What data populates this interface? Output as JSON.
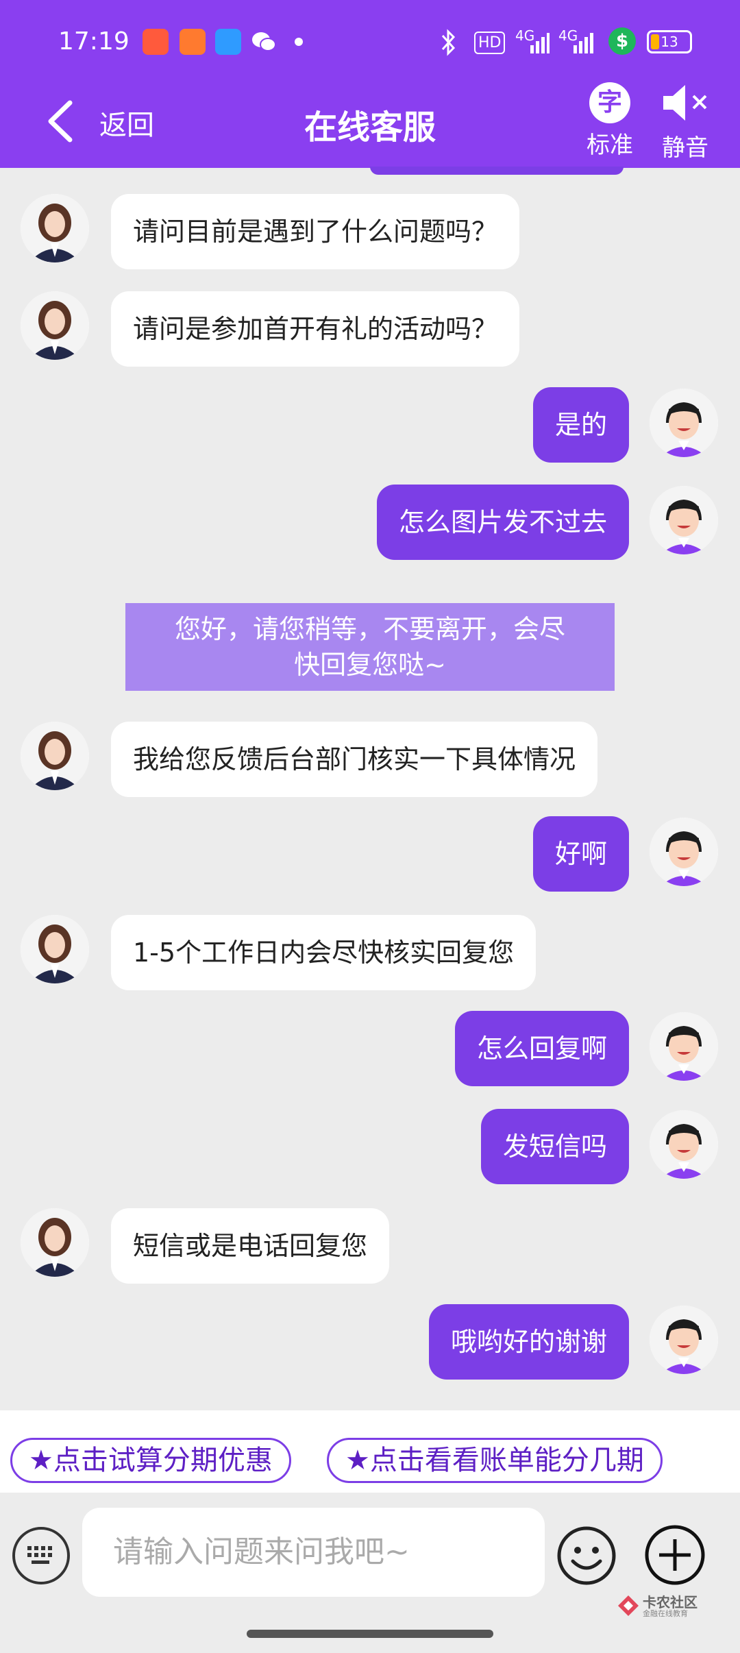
{
  "status_bar": {
    "time": "17:19",
    "battery": "13",
    "network_labels": [
      "HD",
      "4G",
      "4G"
    ]
  },
  "header": {
    "back_label": "返回",
    "title": "在线客服",
    "mode_icon_char": "字",
    "mode_label": "标准",
    "mute_label": "静音"
  },
  "messages": [
    {
      "side": "in",
      "text": "请问目前是遇到了什么问题吗？"
    },
    {
      "side": "in",
      "text": "请问是参加首开有礼的活动吗？"
    },
    {
      "side": "out",
      "text": "是的"
    },
    {
      "side": "out",
      "text": "怎么图片发不过去"
    },
    {
      "side": "notice",
      "text": "您好，请您稍等，不要离开，会尽快回复您哒~"
    },
    {
      "side": "in",
      "text": "我给您反馈后台部门核实一下具体情况"
    },
    {
      "side": "out",
      "text": "好啊"
    },
    {
      "side": "in",
      "text": "1-5个工作日内会尽快核实回复您"
    },
    {
      "side": "out",
      "text": "怎么回复啊"
    },
    {
      "side": "out",
      "text": "发短信吗"
    },
    {
      "side": "in",
      "text": "短信或是电话回复您"
    },
    {
      "side": "out",
      "text": "哦哟好的谢谢"
    }
  ],
  "notice": {
    "line1": "您好，请您稍等，不要离开，会尽",
    "line2": "快回复您哒~"
  },
  "quick_actions": [
    "★点击试算分期优惠",
    "★点击看看账单能分几期"
  ],
  "input": {
    "placeholder": "请输入问题来问我吧~"
  },
  "watermark": {
    "text": "卡农社区",
    "subtext": "金融在线教育"
  },
  "colors": {
    "header": "#8a3ff0",
    "bubble_out": "#7c3ee6",
    "notice": "#a887f0",
    "background": "#ececec"
  }
}
